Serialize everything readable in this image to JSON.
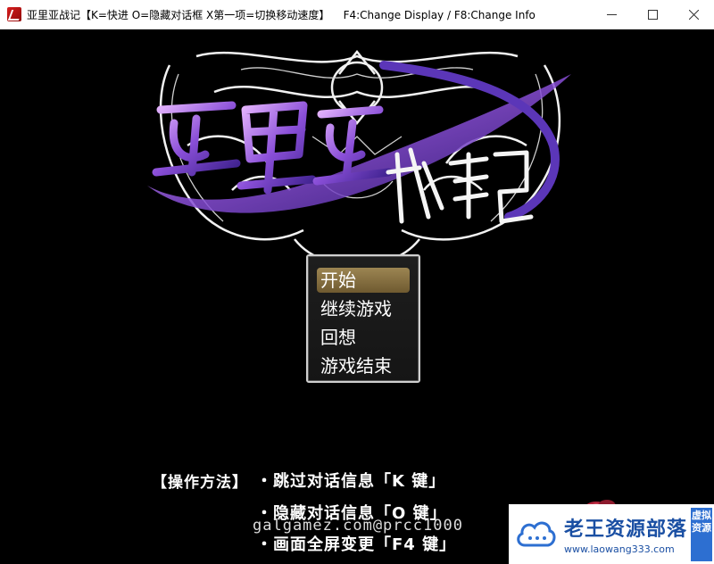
{
  "window": {
    "title": "亚里亚战记【K=快进 O=隐藏对话框 X第一项=切换移动速度】    F4:Change Display / F8:Change Info",
    "minimize_icon": "minimize-icon",
    "maximize_icon": "maximize-icon",
    "close_icon": "close-icon"
  },
  "menu": {
    "items": [
      {
        "label": "开始",
        "selected": true
      },
      {
        "label": "继续游戏",
        "selected": false
      },
      {
        "label": "回想",
        "selected": false
      },
      {
        "label": "游戏结束",
        "selected": false
      }
    ]
  },
  "instructions": {
    "heading": "【操作方法】",
    "lines": [
      "・跳过对话信息「K 键」",
      "・隐藏对话信息「O 键」",
      "・画面全屏变更「F4 键」"
    ]
  },
  "overlay_watermark": "galgamez.com@prcc1000",
  "site_badge": {
    "title": "老王资源部落",
    "url": "www.laowang333.com",
    "stamp": "虚拟资源"
  },
  "colors": {
    "menu_highlight": "#8a7443",
    "logo_purple": "#a060e0",
    "badge_blue": "#1a4fa3"
  }
}
